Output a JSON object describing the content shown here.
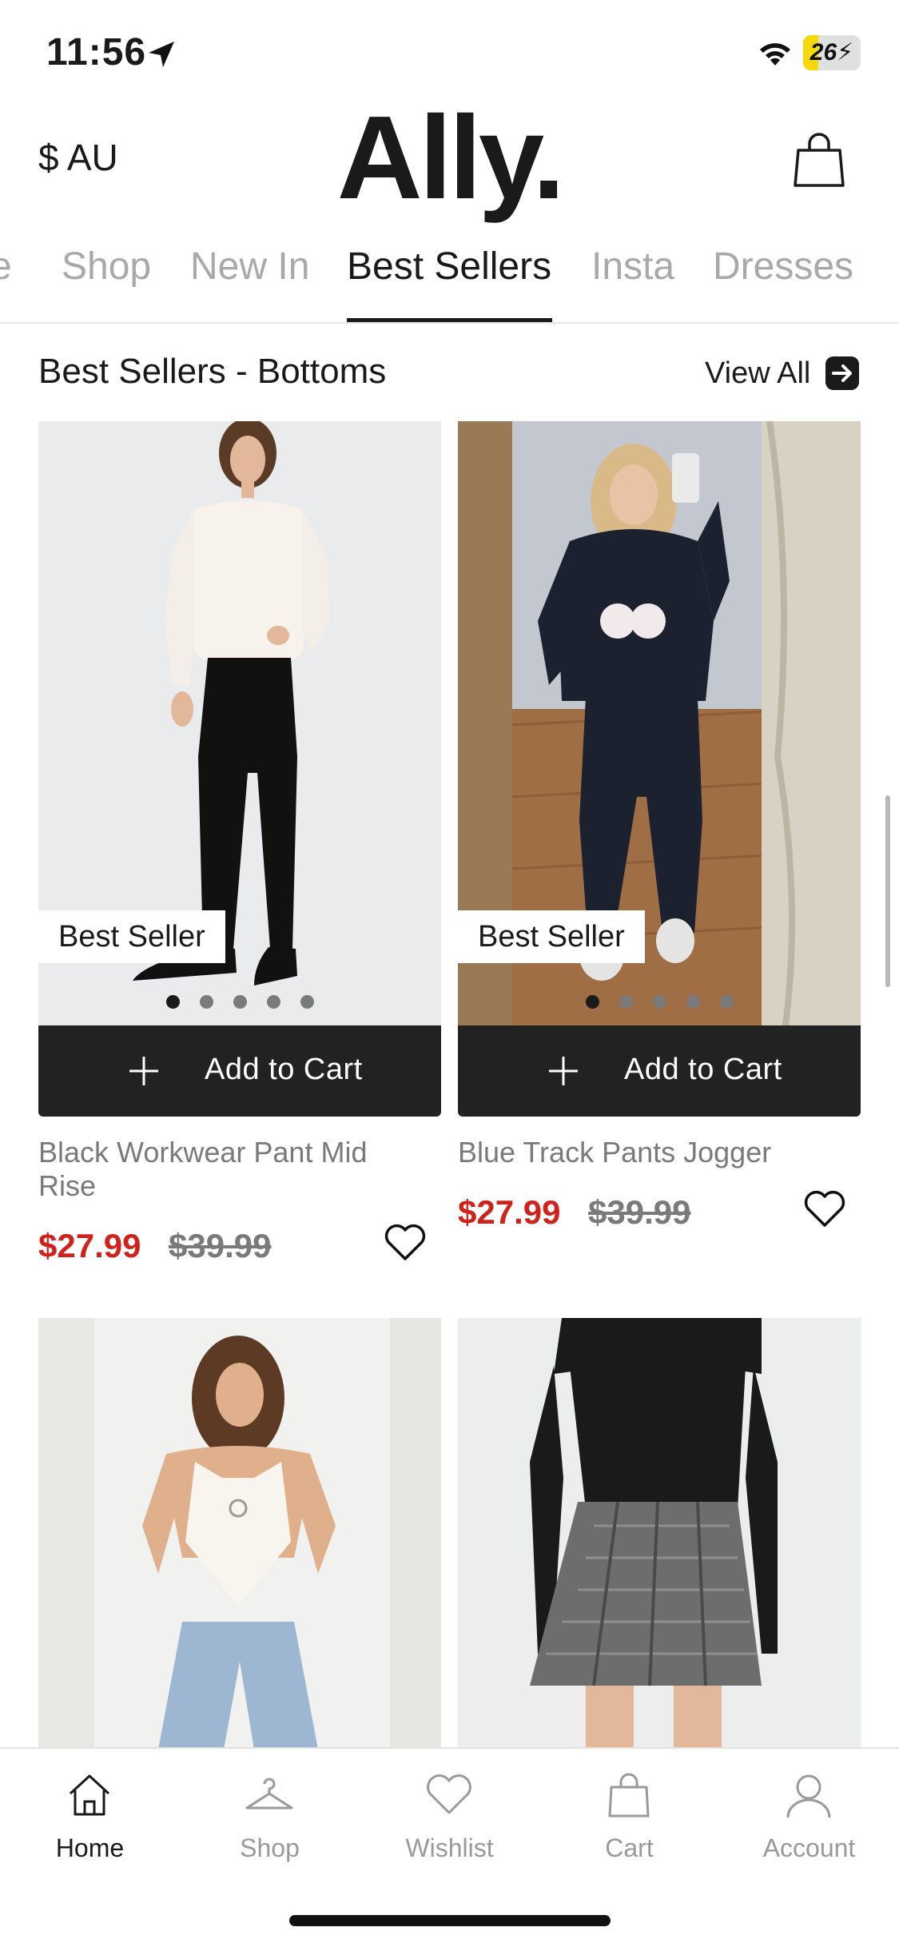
{
  "status_bar": {
    "time": "11:56",
    "battery": "26",
    "battery_level": 0.26,
    "battery_color": "#f5d90a"
  },
  "header": {
    "currency": "$ AU",
    "logo": "Ally.",
    "bag_icon": "shopping-bag-icon"
  },
  "category_tabs": [
    {
      "label": "e",
      "active": false
    },
    {
      "label": "Shop",
      "active": false
    },
    {
      "label": "New In",
      "active": false
    },
    {
      "label": "Best Sellers",
      "active": true
    },
    {
      "label": "Insta",
      "active": false
    },
    {
      "label": "Dresses",
      "active": false
    }
  ],
  "section": {
    "title": "Best Sellers - Bottoms",
    "view_all": "View All",
    "view_all_icon": "arrow-right-icon"
  },
  "products": [
    {
      "badge": "Best Seller",
      "add_to_cart": "Add to Cart",
      "name": "Black Workwear Pant Mid Rise",
      "sale_price": "$27.99",
      "original_price": "$39.99",
      "image_dots": 5,
      "active_dot": 0
    },
    {
      "badge": "Best Seller",
      "add_to_cart": "Add to Cart",
      "name": "Blue Track Pants Jogger",
      "sale_price": "$27.99",
      "original_price": "$39.99",
      "image_dots": 5,
      "active_dot": 0
    },
    {
      "image": "model-white-halter-top-jeans"
    },
    {
      "image": "model-black-top-plaid-skirt"
    }
  ],
  "bottom_nav": [
    {
      "label": "Home",
      "icon": "home-icon",
      "active": true
    },
    {
      "label": "Shop",
      "icon": "hanger-icon",
      "active": false
    },
    {
      "label": "Wishlist",
      "icon": "heart-icon",
      "active": false
    },
    {
      "label": "Cart",
      "icon": "bag-icon",
      "active": false
    },
    {
      "label": "Account",
      "icon": "user-icon",
      "active": false
    }
  ],
  "colors": {
    "accent_dark": "#222222",
    "sale_red": "#d0221b",
    "muted_text": "#7a7a7a",
    "inactive_tab": "#a9a9a9"
  }
}
